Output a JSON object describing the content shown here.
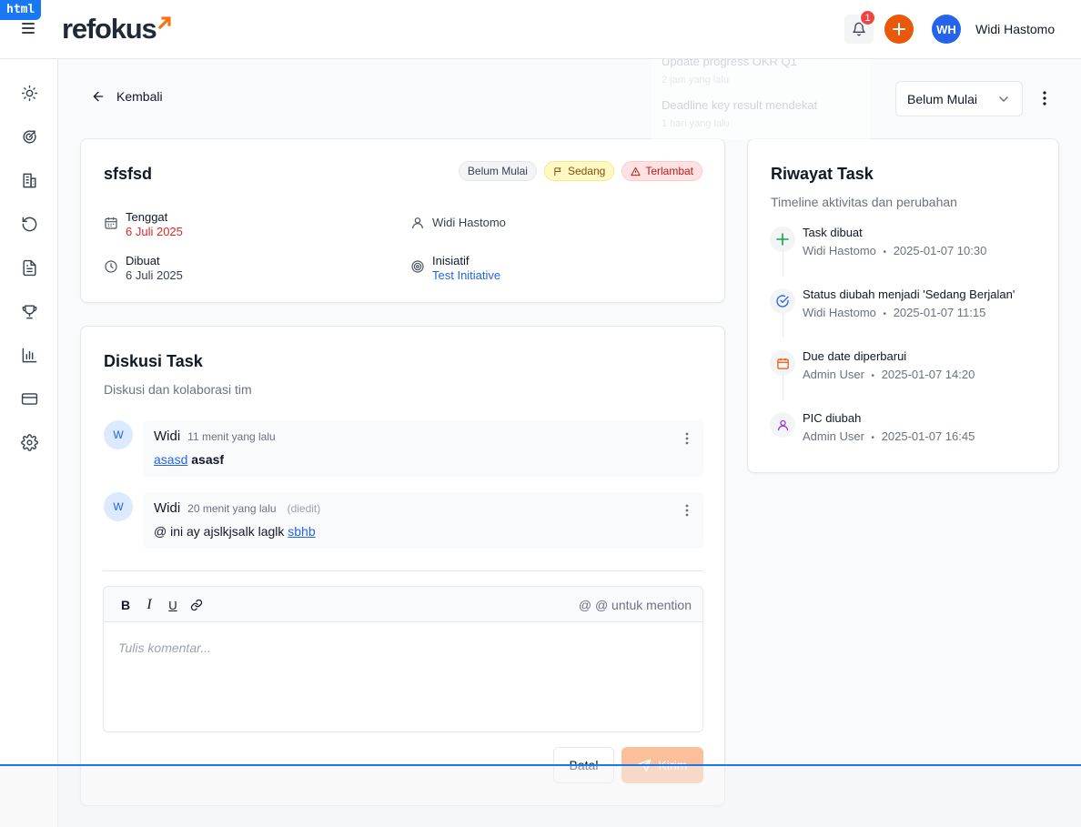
{
  "overlay_tag": "html",
  "header": {
    "logo": "refokus",
    "notification_count": "1",
    "avatar_initials": "WH",
    "user_name": "Widi Hastomo"
  },
  "notifications": [
    {
      "title": "Update progress OKR Q1",
      "time": "2 jam yang lalu"
    },
    {
      "title": "Deadline key result mendekat",
      "time": "1 hari yang lalu"
    }
  ],
  "sidebar": {
    "items": [
      {
        "icon": "sun-icon"
      },
      {
        "icon": "target-icon"
      },
      {
        "icon": "building-icon"
      },
      {
        "icon": "refresh-icon"
      },
      {
        "icon": "document-icon"
      },
      {
        "icon": "trophy-icon"
      },
      {
        "icon": "bar-chart-icon"
      },
      {
        "icon": "credit-card-icon"
      },
      {
        "icon": "gear-icon"
      }
    ]
  },
  "topbar": {
    "back_label": "Kembali",
    "status_value": "Belum Mulai"
  },
  "task": {
    "title": "sfsfsd",
    "badges": {
      "status": "Belum Mulai",
      "priority": "Sedang",
      "late": "Terlambat"
    },
    "due_label": "Tenggat",
    "due_value": "6 Juli 2025",
    "assignee": "Widi Hastomo",
    "created_label": "Dibuat",
    "created_value": "6 Juli 2025",
    "initiative_label": "Inisiatif",
    "initiative_value": "Test Initiative"
  },
  "discussion": {
    "title": "Diskusi Task",
    "subtitle": "Diskusi dan kolaborasi tim",
    "comments": [
      {
        "avatar": "W",
        "author": "Widi",
        "time": "11 menit yang lalu",
        "edited": "",
        "mention": "asasd",
        "text": "asasf"
      },
      {
        "avatar": "W",
        "author": "Widi",
        "time": "20 menit yang lalu",
        "edited": "(diedit)",
        "text": "@ ini ay ajslkjsalk laglk",
        "mention": "sbhb"
      }
    ],
    "editor": {
      "bold": "B",
      "italic": "I",
      "underline": "U",
      "mention_hint": "@ @ untuk mention",
      "placeholder": "Tulis komentar..."
    },
    "cancel_label": "Batal",
    "send_label": "Kirim"
  },
  "history": {
    "title": "Riwayat Task",
    "subtitle": "Timeline aktivitas dan perubahan",
    "items": [
      {
        "title": "Task dibuat",
        "user": "Widi Hastomo",
        "time": "2025-01-07 10:30",
        "icon": "plus-icon",
        "color": "#16a34a"
      },
      {
        "title": "Status diubah menjadi 'Sedang Berjalan'",
        "user": "Widi Hastomo",
        "time": "2025-01-07 11:15",
        "icon": "check-circle-icon",
        "color": "#2563eb"
      },
      {
        "title": "Due date diperbarui",
        "user": "Admin User",
        "time": "2025-01-07 14:20",
        "icon": "calendar-icon",
        "color": "#ea580c"
      },
      {
        "title": "PIC diubah",
        "user": "Admin User",
        "time": "2025-01-07 16:45",
        "icon": "user-icon",
        "color": "#9333ea"
      }
    ],
    "separator": "•"
  },
  "colors": {
    "brand_orange": "#ea580c",
    "primary_blue": "#2563eb",
    "danger": "#dc2626"
  }
}
